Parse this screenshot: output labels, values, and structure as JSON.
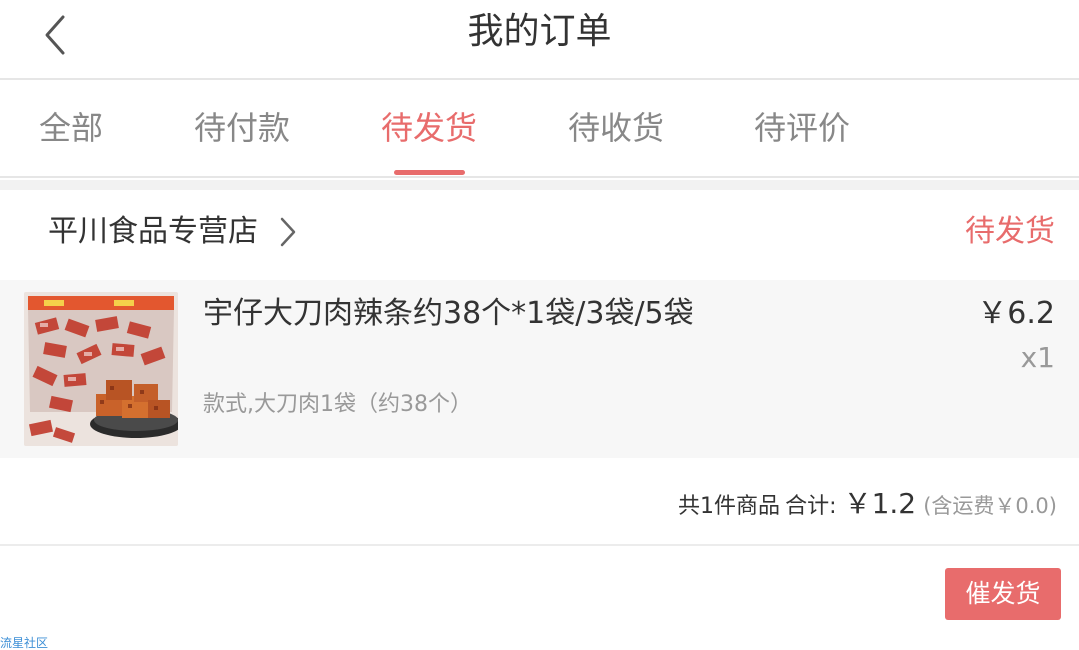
{
  "header": {
    "title": "我的订单",
    "back_icon": "chevron-left-icon"
  },
  "tabs": [
    {
      "label": "全部",
      "active": false
    },
    {
      "label": "待付款",
      "active": false
    },
    {
      "label": "待发货",
      "active": true
    },
    {
      "label": "待收货",
      "active": false
    },
    {
      "label": "待评价",
      "active": false
    }
  ],
  "order": {
    "store_name": "平川食品专营店",
    "store_chevron_icon": "chevron-right-icon",
    "status": "待发货",
    "item": {
      "title": "宇仔大刀肉辣条约38个*1袋/3袋/5袋",
      "spec": "款式,大刀肉1袋（约38个）",
      "price": "￥6.2",
      "quantity": "x1",
      "image_icon": "product-image"
    },
    "summary": {
      "count_text": "共1件商品",
      "total_label": "合计:",
      "total_value": "￥1.2",
      "shipping_text": "(含运费￥0.0)"
    },
    "action_button": "催发货"
  },
  "watermark": "流星社区",
  "colors": {
    "accent": "#e86c6c",
    "text_primary": "#333333",
    "text_secondary": "#999999",
    "tab_inactive": "#888888",
    "item_bg": "#f7f7f7",
    "watermark": "#3d8fd6"
  }
}
